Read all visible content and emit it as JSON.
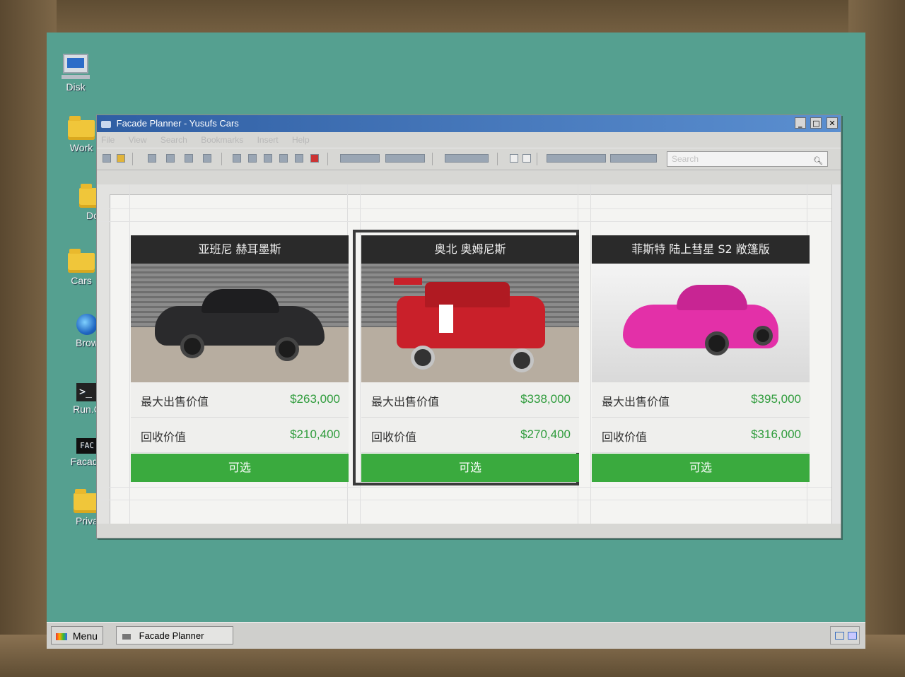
{
  "desktop": {
    "icons": [
      {
        "label": "Disk",
        "icon": "computer-icon"
      },
      {
        "label": "Work",
        "icon": "folder-icon"
      },
      {
        "label": "Do",
        "icon": "folder-icon"
      },
      {
        "label": "Cars",
        "icon": "folder-icon"
      },
      {
        "label": "Brow",
        "icon": "globe-icon"
      },
      {
        "label": "Run.C",
        "icon": "terminal-icon",
        "glyph": ">_"
      },
      {
        "label": "Facade",
        "icon": "facade-icon",
        "glyph": "FAC"
      },
      {
        "label": "Priva",
        "icon": "folder-icon"
      }
    ]
  },
  "window": {
    "title": "Facade Planner - Yusufs Cars",
    "buttons": {
      "minimize": "_",
      "maximize": "□",
      "close": "✕"
    },
    "menu": [
      "File",
      "View",
      "Search",
      "Bookmarks",
      "Insert",
      "Help"
    ],
    "search_placeholder": "Search"
  },
  "cards": [
    {
      "title": "亚班尼 赫耳墨斯",
      "max_label": "最大出售价值",
      "max_value": "$263,000",
      "recycle_label": "回收价值",
      "recycle_value": "$210,400",
      "button": "可选",
      "car_color": "#2a2a2c",
      "selected": false
    },
    {
      "title": "奥北 奥姆尼斯",
      "max_label": "最大出售价值",
      "max_value": "$338,000",
      "recycle_label": "回收价值",
      "recycle_value": "$270,400",
      "button": "可选",
      "car_color": "#c9202a",
      "selected": true
    },
    {
      "title": "菲斯特 陆上彗星 S2 敞篷版",
      "max_label": "最大出售价值",
      "max_value": "$395,000",
      "recycle_label": "回收价值",
      "recycle_value": "$316,000",
      "button": "可选",
      "car_color": "#e330a8",
      "selected": false
    }
  ],
  "taskbar": {
    "menu_label": "Menu",
    "task_label": "Facade Planner"
  },
  "colors": {
    "desktop": "#55a090",
    "accent_green": "#3aaa3e",
    "value_green": "#2f9c3c",
    "card_header": "#2a2a2a"
  }
}
